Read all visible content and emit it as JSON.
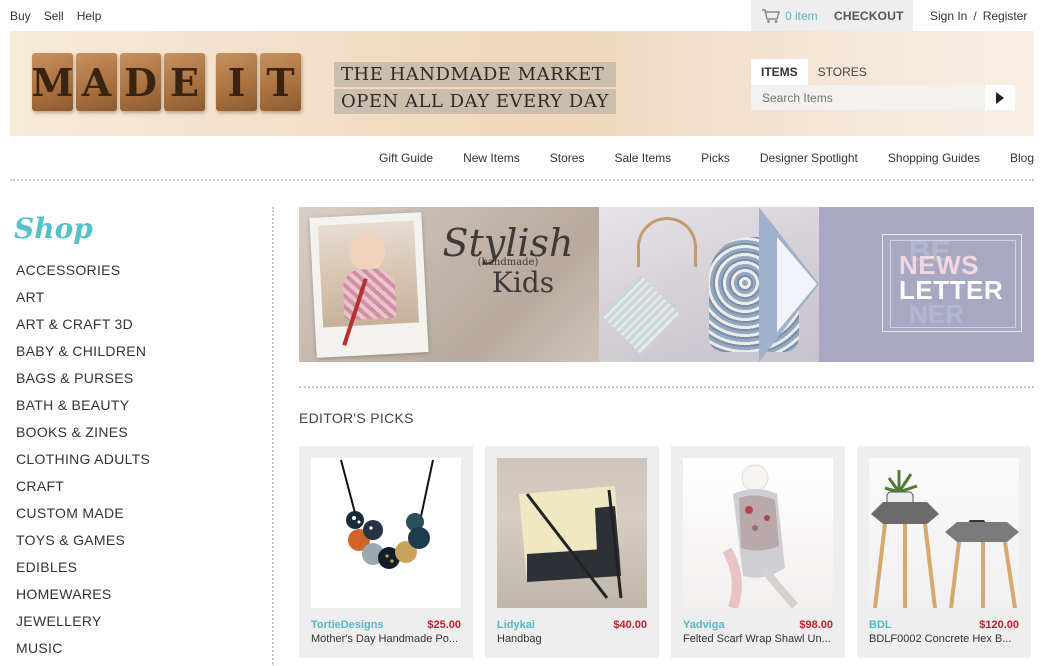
{
  "topnav": {
    "buy": "Buy",
    "sell": "Sell",
    "help": "Help"
  },
  "cart": {
    "count": "0 item",
    "checkout": "CHECKOUT",
    "icon": "cart-icon"
  },
  "account": {
    "signin": "Sign In",
    "separator": "/",
    "register": "Register"
  },
  "logo": {
    "letters": [
      "M",
      "A",
      "D",
      "E",
      "I",
      "T"
    ]
  },
  "tagline": {
    "line1": "THE HANDMADE MARKET",
    "line2": "OPEN ALL DAY EVERY DAY"
  },
  "search": {
    "tab_items": "ITEMS",
    "tab_stores": "STORES",
    "placeholder": "Search Items",
    "icon": "play-arrow-icon"
  },
  "mainnav": [
    "Gift Guide",
    "New Items",
    "Stores",
    "Sale Items",
    "Picks",
    "Designer Spotlight",
    "Shopping Guides",
    "Blog"
  ],
  "sidebar": {
    "title": "Shop",
    "categories": [
      "ACCESSORIES",
      "ART",
      "ART & CRAFT 3D",
      "BABY & CHILDREN",
      "BAGS & PURSES",
      "BATH & BEAUTY",
      "BOOKS & ZINES",
      "CLOTHING ADULTS",
      "CRAFT",
      "CUSTOM MADE",
      "TOYS & GAMES",
      "EDIBLES",
      "HOMEWARES",
      "JEWELLERY",
      "MUSIC"
    ]
  },
  "hero": {
    "stylish": "Stylish",
    "handmade": "(handmade)",
    "kids": "Kids",
    "newsletter_line1": "NEWS",
    "newsletter_line2": "LETTER"
  },
  "picks": {
    "title": "EDITOR'S PICKS",
    "items": [
      {
        "store": "TortieDesigns",
        "price": "$25.00",
        "title": "Mother's Day Handmade Po..."
      },
      {
        "store": "Lidykai",
        "price": "$40.00",
        "title": "Handbag"
      },
      {
        "store": "Yadviga",
        "price": "$98.00",
        "title": "Felted Scarf Wrap Shawl Un..."
      },
      {
        "store": "BDL",
        "price": "$120.00",
        "title": "BDLF0002 Concrete Hex B..."
      }
    ]
  },
  "colors": {
    "accent": "#53b9c4",
    "price": "#c0202a",
    "card_bg": "#eeeeee",
    "banner": "#f3dcc4"
  }
}
